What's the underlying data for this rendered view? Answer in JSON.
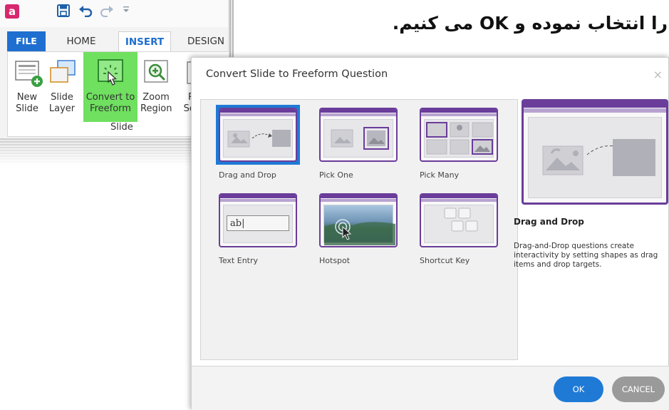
{
  "caption": "را انتخاب نموده و OK می کنیم.",
  "ribbon": {
    "tabs": {
      "file": "FILE",
      "home": "HOME",
      "insert": "INSERT",
      "design": "DESIGN"
    },
    "buttons": {
      "new_slide": "New\nSlide",
      "slide_layer": "Slide\nLayer",
      "convert_to_freeform": "Convert to\nFreeform",
      "zoom_region": "Zoom\nRegion",
      "partial": "R\nSc"
    },
    "group_label": "Slide"
  },
  "dialog": {
    "title": "Convert Slide to Freeform Question",
    "close": "×",
    "question_types": [
      {
        "label": "Drag and Drop",
        "selected": true
      },
      {
        "label": "Pick One",
        "selected": false
      },
      {
        "label": "Pick Many",
        "selected": false
      },
      {
        "label": "Text Entry",
        "selected": false
      },
      {
        "label": "Hotspot",
        "selected": false
      },
      {
        "label": "Shortcut Key",
        "selected": false
      }
    ],
    "text_entry_sample": "ab|",
    "preview": {
      "title": "Drag and Drop",
      "description": "Drag-and-Drop questions create interactivity by setting shapes as drag items and drop targets."
    },
    "ok_label": "OK",
    "cancel_label": "CANCEL"
  },
  "colors": {
    "accent_blue": "#1f7ad6",
    "purple": "#6a3d9a",
    "highlight_green": "#6fe05f",
    "file_tab": "#1f6fd0"
  }
}
